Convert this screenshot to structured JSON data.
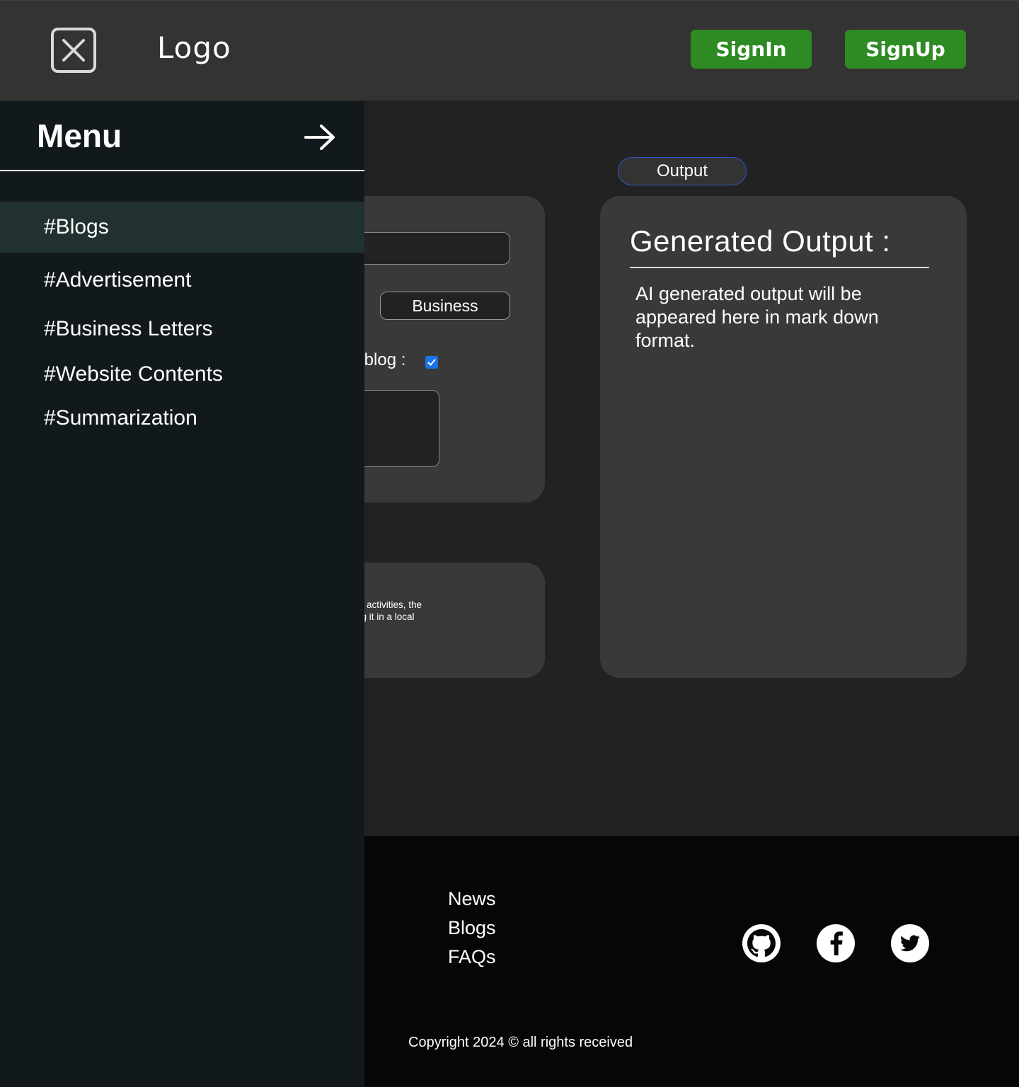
{
  "header": {
    "logo": "Logo",
    "signin_label": "SignIn",
    "signup_label": "SignUp"
  },
  "menu": {
    "title": "Menu",
    "items": [
      {
        "label": "#Blogs",
        "active": true
      },
      {
        "label": "#Advertisement",
        "active": false
      },
      {
        "label": "#Business Letters",
        "active": false
      },
      {
        "label": "#Website Contents",
        "active": false
      },
      {
        "label": "#Summarization",
        "active": false
      }
    ]
  },
  "main": {
    "output_tab": "Output",
    "category_pill": "Business",
    "blog_option_label": "r blog :",
    "blog_option_checked": true,
    "info_lines": [
      "ful activities, the",
      "ing it in a local"
    ],
    "output_title": "Generated Output :",
    "output_body": "AI generated output will be appeared here in mark down format."
  },
  "footer": {
    "links": [
      "News",
      "Blogs",
      "FAQs"
    ],
    "social_icons": [
      "github-icon",
      "facebook-icon",
      "twitter-icon"
    ],
    "copyright": "Copyright 2024 © all rights received"
  },
  "colors": {
    "header_bg": "#333333",
    "page_bg": "#222222",
    "button_green": "#2e8a23",
    "menu_bg": "#12191c",
    "menu_active_bg": "#213130",
    "footer_bg": "#060606",
    "pill_border": "#2f56c8"
  }
}
